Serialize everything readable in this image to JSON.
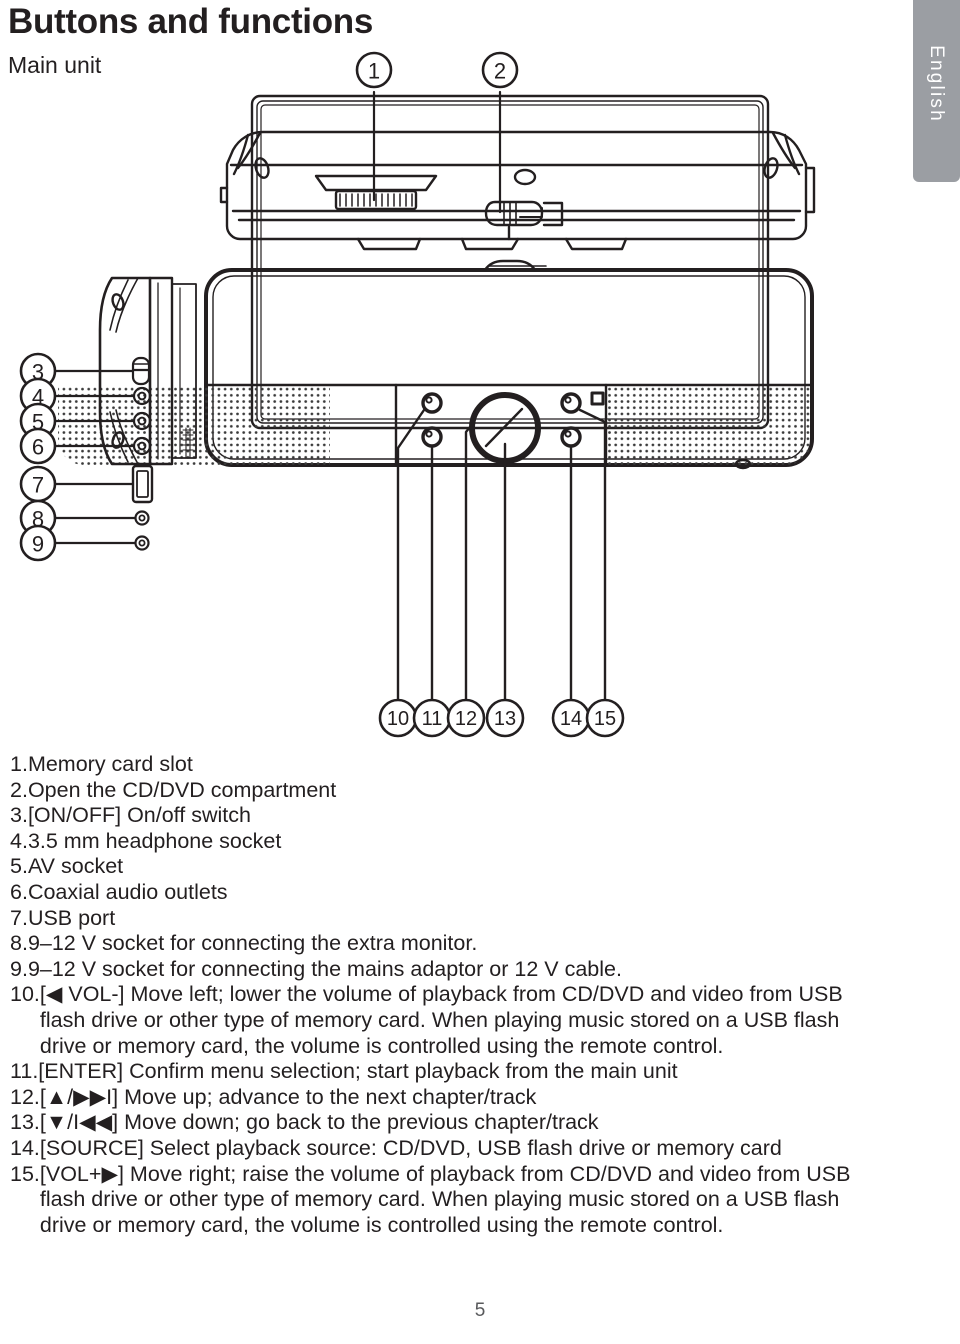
{
  "header": {
    "title": "Buttons and functions",
    "section": "Main unit"
  },
  "side_tab": {
    "label": "English"
  },
  "diagram": {
    "name": "main-unit-diagram",
    "callouts": [
      {
        "id": "1",
        "label": "1"
      },
      {
        "id": "2",
        "label": "2"
      },
      {
        "id": "3",
        "label": "3"
      },
      {
        "id": "4",
        "label": "4"
      },
      {
        "id": "5",
        "label": "5"
      },
      {
        "id": "6",
        "label": "6"
      },
      {
        "id": "7",
        "label": "7"
      },
      {
        "id": "8",
        "label": "8"
      },
      {
        "id": "9",
        "label": "9"
      },
      {
        "id": "10",
        "label": "10"
      },
      {
        "id": "11",
        "label": "11"
      },
      {
        "id": "12",
        "label": "12"
      },
      {
        "id": "13",
        "label": "13"
      },
      {
        "id": "14",
        "label": "14"
      },
      {
        "id": "15",
        "label": "15"
      }
    ]
  },
  "instructions": [
    {
      "num": "1.",
      "text": "Memory card slot"
    },
    {
      "num": "2.",
      "text": "Open the CD/DVD compartment"
    },
    {
      "num": "3.",
      "text": "[ON/OFF] On/off switch"
    },
    {
      "num": "4.",
      "text": "3.5 mm headphone socket"
    },
    {
      "num": "5.",
      "text": "AV socket"
    },
    {
      "num": "6.",
      "text": "Coaxial audio outlets"
    },
    {
      "num": "7.",
      "text": "USB port"
    },
    {
      "num": "8.",
      "text": "9–12 V socket for connecting the extra monitor."
    },
    {
      "num": "9.",
      "text": "9–12 V socket for connecting the mains adaptor or 12 V cable."
    },
    {
      "num": "10.",
      "text": "[◀ VOL-] Move left; lower the volume of playback from CD/DVD and video from USB flash drive or other type of memory card. When playing music stored on a USB flash drive or memory card, the volume is controlled using the remote control."
    },
    {
      "num": "11.",
      "text": "[ENTER] Confirm menu selection; start playback from the main unit"
    },
    {
      "num": "12.",
      "text": "[▲/▶▶I] Move up; advance to the next chapter/track"
    },
    {
      "num": "13.",
      "text": "[▼/I◀◀] Move down; go back to the previous chapter/track"
    },
    {
      "num": "14.",
      "text": "[SOURCE] Select playback source: CD/DVD, USB flash drive or memory card"
    },
    {
      "num": "15.",
      "text": "[VOL+▶] Move right; raise the volume of playback from CD/DVD and video from USB flash drive or other type of memory card. When playing music stored on a USB flash drive or memory card, the volume is controlled using the remote control."
    }
  ],
  "footer": {
    "page_number": "5"
  }
}
